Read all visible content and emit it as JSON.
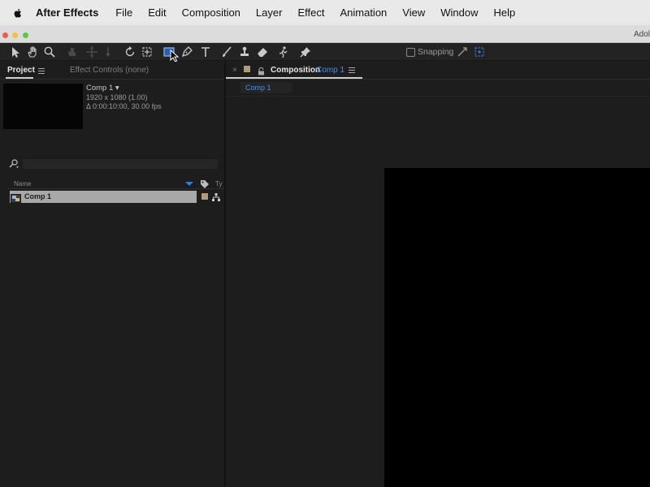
{
  "menubar": {
    "app_name": "After Effects",
    "items": [
      "File",
      "Edit",
      "Composition",
      "Layer",
      "Effect",
      "Animation",
      "View",
      "Window",
      "Help"
    ]
  },
  "window": {
    "title": "Adol"
  },
  "toolbar": {
    "tools": [
      "selection-tool",
      "hand-tool",
      "zoom-tool",
      "orbit-camera-tool",
      "pan-camera-tool",
      "dolly-camera-tool",
      "rotation-tool",
      "pan-behind-tool",
      "rectangle-tool",
      "pen-tool",
      "type-tool",
      "brush-tool",
      "clone-stamp-tool",
      "eraser-tool",
      "roto-brush-tool",
      "puppet-pin-tool"
    ],
    "active_tool": "rectangle-tool",
    "snapping_label": "Snapping",
    "snapping_checked": false
  },
  "project_panel": {
    "tab_label": "Project",
    "effect_controls_label": "Effect Controls (none)",
    "selected_item": {
      "name": "Comp 1 ▾",
      "resolution": "1920 x 1080 (1.00)",
      "duration": "Δ 0:00:10:00, 30.00 fps"
    },
    "search": {
      "placeholder": "",
      "value": ""
    },
    "columns": {
      "name": "Name",
      "type": "Ty"
    },
    "items": [
      {
        "name": "Comp 1",
        "label_color": "#b49a74",
        "selected": true
      }
    ]
  },
  "composition_panel": {
    "tab_title": "Composition",
    "tab_comp_name": "Comp 1",
    "breadcrumb": "Comp 1",
    "label_color": "#b49a74"
  },
  "colors": {
    "accent_blue": "#4d8ee6",
    "panel_bg": "#1d1d1d",
    "label_sandstone": "#b49a74"
  }
}
